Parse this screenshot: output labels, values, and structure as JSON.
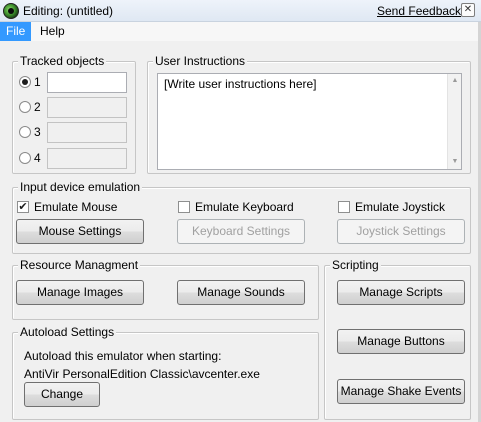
{
  "window": {
    "title": "Editing: (untitled)",
    "feedback_link": "Send Feedback",
    "close_glyph": "✕"
  },
  "menu": {
    "items": [
      {
        "label": "File",
        "active": true
      },
      {
        "label": "Help",
        "active": false
      }
    ]
  },
  "tracked_objects": {
    "group_label": "Tracked objects",
    "rows": [
      {
        "number": "1",
        "selected": true,
        "value": "",
        "enabled": true
      },
      {
        "number": "2",
        "selected": false,
        "value": "",
        "enabled": false
      },
      {
        "number": "3",
        "selected": false,
        "value": "",
        "enabled": false
      },
      {
        "number": "4",
        "selected": false,
        "value": "",
        "enabled": false
      }
    ]
  },
  "user_instructions": {
    "group_label": "User Instructions",
    "text": "[Write user instructions here]"
  },
  "input_device": {
    "group_label": "Input device emulation",
    "emulate_mouse": {
      "label": "Emulate Mouse",
      "checked": true,
      "mark": "✔"
    },
    "emulate_keyboard": {
      "label": "Emulate Keyboard",
      "checked": false
    },
    "emulate_joystick": {
      "label": "Emulate Joystick",
      "checked": false
    },
    "mouse_settings": {
      "label": "Mouse Settings",
      "enabled": true
    },
    "keyboard_settings": {
      "label": "Keyboard Settings",
      "enabled": false
    },
    "joystick_settings": {
      "label": "Joystick Settings",
      "enabled": false
    }
  },
  "resource": {
    "group_label": "Resource Managment",
    "manage_images": "Manage Images",
    "manage_sounds": "Manage Sounds"
  },
  "scripting": {
    "group_label": "Scripting",
    "manage_scripts": "Manage Scripts",
    "manage_buttons": "Manage Buttons",
    "manage_shake_events": "Manage Shake Events"
  },
  "autoload": {
    "group_label": "Autoload Settings",
    "description": "Autoload this emulator when starting:",
    "target": "AntiVir PersonalEdition Classic\\avcenter.exe",
    "change_button": "Change"
  },
  "icons": {
    "app": "app-logo-icon",
    "close": "close-icon",
    "scroll_up": "scroll-up-arrow-icon",
    "scroll_down": "scroll-down-arrow-icon",
    "checkmark": "checkmark-icon"
  },
  "colors": {
    "window_bg": "#f0f0f0",
    "menu_active": "#3399ff",
    "group_border": "#c6c6c6",
    "disabled_text": "#a0a0a0"
  }
}
